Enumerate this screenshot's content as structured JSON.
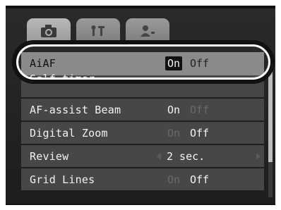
{
  "tabs": [
    {
      "icon": "camera-icon",
      "active": true
    },
    {
      "icon": "settings-tools-icon",
      "active": false
    },
    {
      "icon": "person-icon",
      "active": false
    }
  ],
  "menu": {
    "rows": [
      {
        "label": "AiAF",
        "option_on": "On",
        "option_off": "Off",
        "selected": "On"
      },
      {
        "label": "Self-timer",
        "value": ""
      },
      {
        "label": "AF-assist Beam",
        "option_on": "On",
        "option_off": "Off",
        "selected": "On"
      },
      {
        "label": "Digital Zoom",
        "option_on": "On",
        "option_off": "Off",
        "selected": "Off"
      },
      {
        "label": "Review",
        "value": "2 sec."
      },
      {
        "label": "Grid Lines",
        "option_on": "On",
        "option_off": "Off",
        "selected": "Off"
      }
    ]
  }
}
